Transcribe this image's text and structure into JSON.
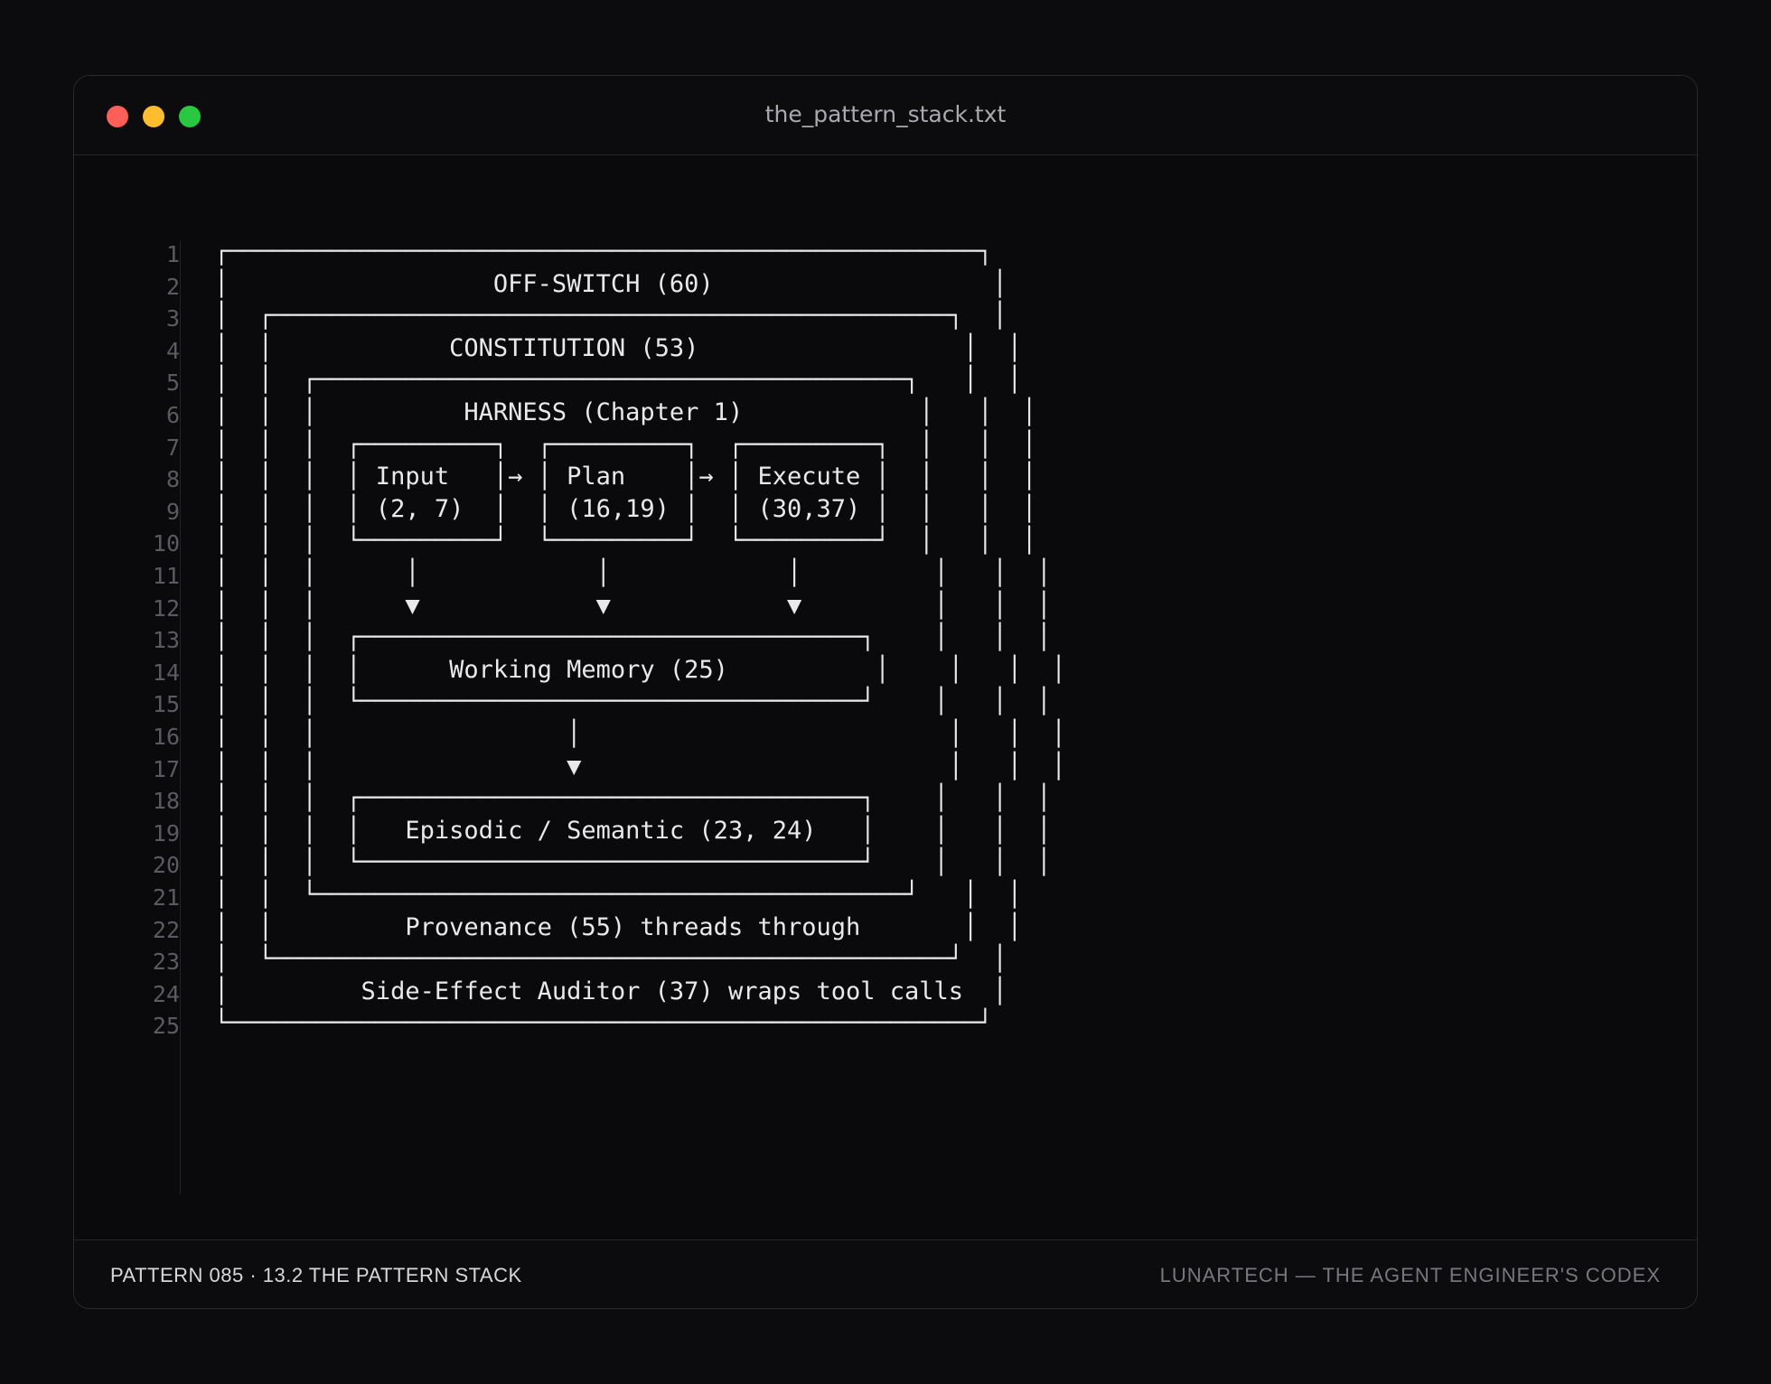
{
  "window": {
    "title": "the_pattern_stack.txt",
    "traffic_lights": [
      "close",
      "minimize",
      "zoom"
    ]
  },
  "editor": {
    "line_numbers": [
      "1",
      "2",
      "3",
      "4",
      "5",
      "6",
      "7",
      "8",
      "9",
      "10",
      "11",
      "12",
      "13",
      "14",
      "15",
      "16",
      "17",
      "18",
      "19",
      "20",
      "21",
      "22",
      "23",
      "24",
      "25"
    ],
    "lines": [
      "┌───────────────────────────────────────────────────┐",
      "│                  OFF-SWITCH (60)                   │",
      "│  ┌──────────────────────────────────────────────┐  │",
      "│  │            CONSTITUTION (53)                  │  │",
      "│  │  ┌────────────────────────────────────────┐   │  │",
      "│  │  │          HARNESS (Chapter 1)            │   │  │",
      "│  │  │  ┌─────────┐  ┌─────────┐  ┌─────────┐  │   │  │",
      "│  │  │  │ Input   │→ │ Plan    │→ │ Execute │  │   │  │",
      "│  │  │  │ (2, 7)  │  │ (16,19) │  │ (30,37) │  │   │  │",
      "│  │  │  └─────────┘  └─────────┘  └─────────┘  │   │  │",
      "│  │  │      │            │            │         │   │  │",
      "│  │  │      ▼            ▼            ▼         │   │  │",
      "│  │  │  ┌──────────────────────────────────┐    │   │  │",
      "│  │  │  │      Working Memory (25)          │    │   │  │",
      "│  │  │  └──────────────────────────────────┘    │   │  │",
      "│  │  │                 │                         │   │  │",
      "│  │  │                 ▼                         │   │  │",
      "│  │  │  ┌──────────────────────────────────┐    │   │  │",
      "│  │  │  │   Episodic / Semantic (23, 24)   │    │   │  │",
      "│  │  │  └──────────────────────────────────┘    │   │  │",
      "│  │  └────────────────────────────────────────┘   │  │",
      "│  │         Provenance (55) threads through       │  │",
      "│  └──────────────────────────────────────────────┘  │",
      "│         Side-Effect Auditor (37) wraps tool calls  │",
      "└───────────────────────────────────────────────────┘"
    ]
  },
  "footer": {
    "left": "PATTERN 085 · 13.2 THE PATTERN STACK",
    "right": "LUNARTECH — THE AGENT ENGINEER'S CODEX"
  },
  "colors": {
    "background": "#0c0c0e",
    "text": "#e9e9ec",
    "line_number": "#5a5a60",
    "red": "#ff5f57",
    "yellow": "#febc2e",
    "green": "#28c840"
  }
}
